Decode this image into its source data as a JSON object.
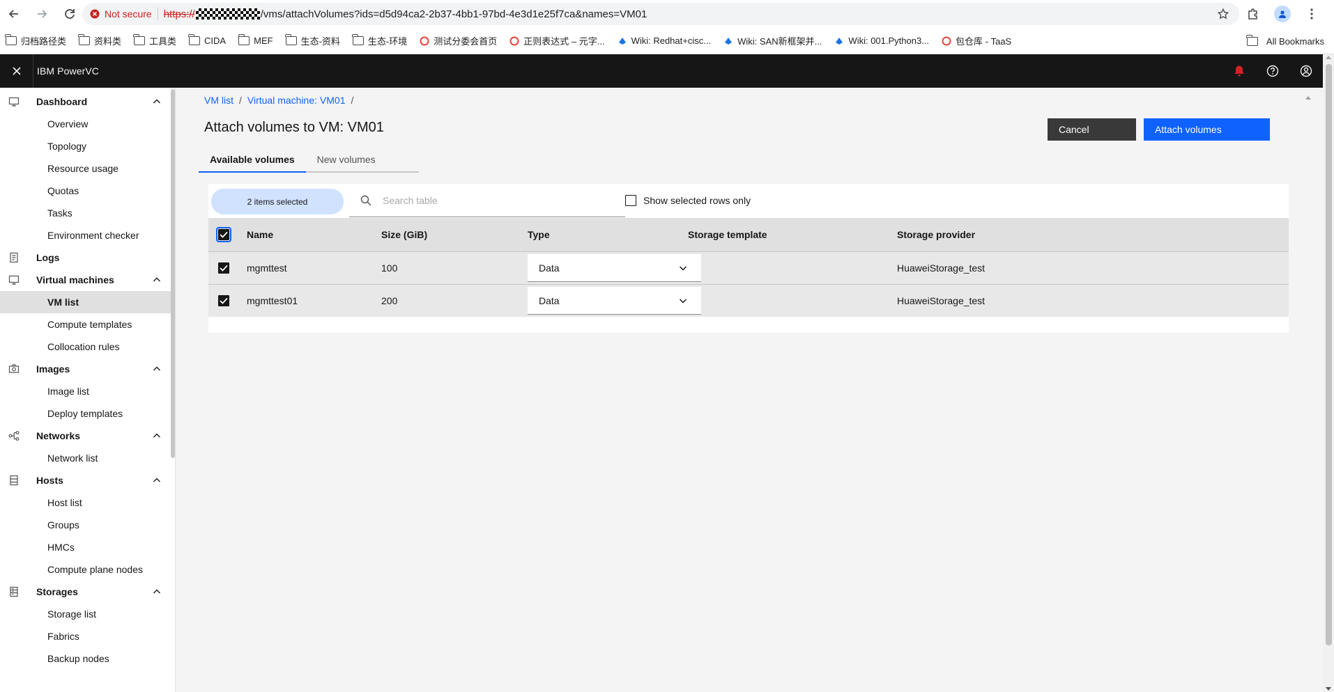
{
  "browser": {
    "security_label": "Not secure",
    "url_scheme": "https://",
    "url_rest": "/vms/attachVolumes?ids=d5d94ca2-2b37-4bb1-97bd-4e3d1e25f7ca&names=VM01",
    "bookmarks": [
      {
        "label": "归档路径类",
        "icon": "folder-icon"
      },
      {
        "label": "资料类",
        "icon": "folder-icon"
      },
      {
        "label": "工具类",
        "icon": "folder-icon"
      },
      {
        "label": "CIDA",
        "icon": "folder-icon"
      },
      {
        "label": "MEF",
        "icon": "folder-icon"
      },
      {
        "label": "生态-资料",
        "icon": "folder-icon"
      },
      {
        "label": "生态-环境",
        "icon": "folder-icon"
      },
      {
        "label": "测试分委会首页",
        "icon": "site-icon"
      },
      {
        "label": "正则表达式 – 元字...",
        "icon": "site-icon"
      },
      {
        "label": "Wiki: Redhat+cisc...",
        "icon": "wiki-icon"
      },
      {
        "label": "Wiki: SAN新框架并...",
        "icon": "wiki-icon"
      },
      {
        "label": "Wiki: 001.Python3...",
        "icon": "wiki-icon"
      },
      {
        "label": "包仓库 - TaaS",
        "icon": "site-icon"
      }
    ],
    "all_bookmarks": "All Bookmarks"
  },
  "header": {
    "brand": "IBM PowerVC",
    "notification_color": "#da1e28"
  },
  "sidebar": {
    "sections": [
      {
        "label": "Dashboard",
        "icon": "monitor-icon",
        "items": [
          "Overview",
          "Topology",
          "Resource usage",
          "Quotas",
          "Tasks",
          "Environment checker"
        ]
      },
      {
        "label": "Logs",
        "icon": "log-icon",
        "items": []
      },
      {
        "label": "Virtual machines",
        "icon": "monitor-icon",
        "items": [
          "VM list",
          "Compute templates",
          "Collocation rules"
        ]
      },
      {
        "label": "Images",
        "icon": "camera-icon",
        "items": [
          "Image list",
          "Deploy templates"
        ]
      },
      {
        "label": "Networks",
        "icon": "network-icon",
        "items": [
          "Network list"
        ]
      },
      {
        "label": "Hosts",
        "icon": "server-icon",
        "items": [
          "Host list",
          "Groups",
          "HMCs",
          "Compute plane nodes"
        ]
      },
      {
        "label": "Storages",
        "icon": "storage-icon",
        "items": [
          "Storage list",
          "Fabrics",
          "Backup nodes"
        ]
      }
    ],
    "active_item": "VM list"
  },
  "main": {
    "breadcrumb": [
      "VM list",
      "Virtual machine: VM01"
    ],
    "title": "Attach volumes to VM: VM01",
    "cancel_label": "Cancel",
    "attach_label": "Attach volumes",
    "tabs": [
      "Available volumes",
      "New volumes"
    ],
    "batch_label": "2 items selected",
    "search_placeholder": "Search table",
    "show_selected_label": "Show selected rows only",
    "columns": [
      "Name",
      "Size (GiB)",
      "Type",
      "Storage template",
      "Storage provider"
    ],
    "rows": [
      {
        "name": "mgmttest",
        "size": "100",
        "type": "Data",
        "template": "",
        "provider": "HuaweiStorage_test",
        "checked": true
      },
      {
        "name": "mgmttest01",
        "size": "200",
        "type": "Data",
        "template": "",
        "provider": "HuaweiStorage_test",
        "checked": true
      }
    ]
  }
}
